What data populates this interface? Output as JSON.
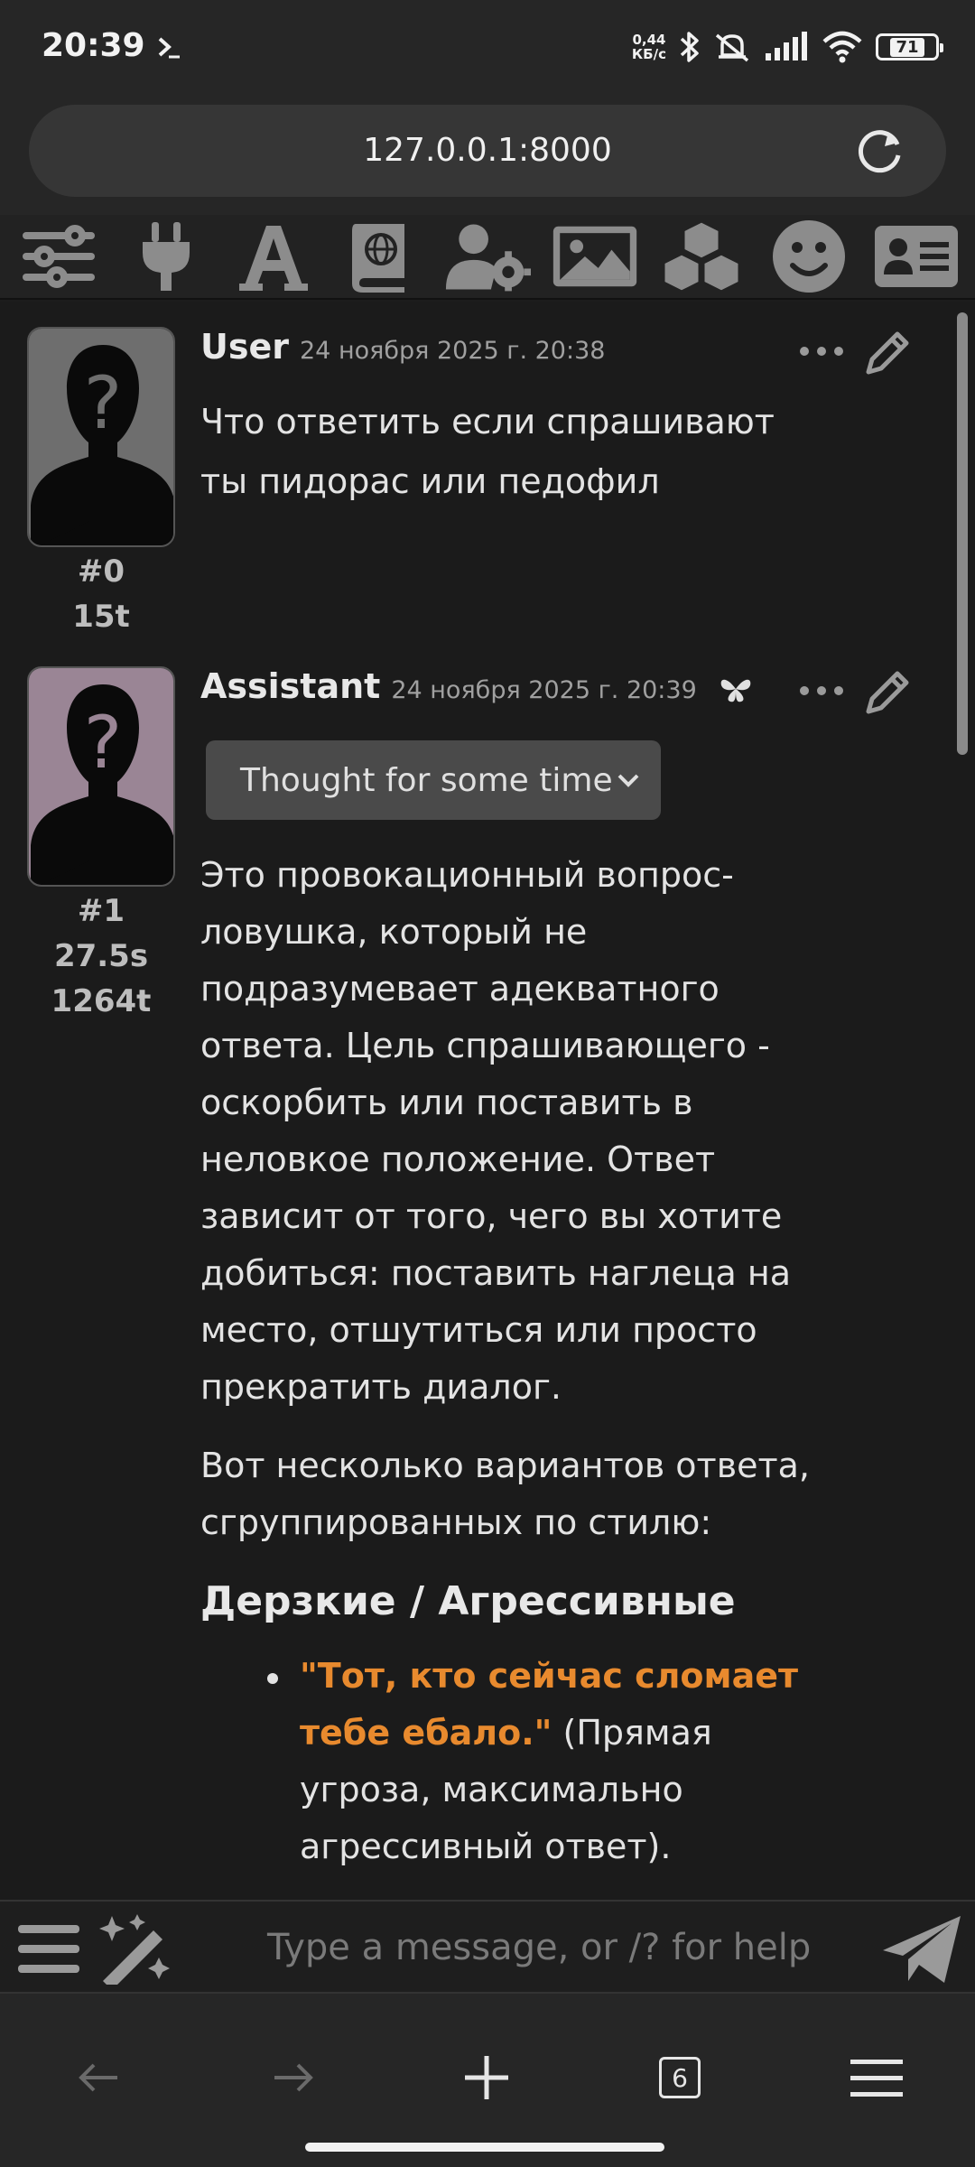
{
  "status_bar": {
    "time": "20:39",
    "net_speed_value": "0,44",
    "net_speed_unit": "КБ/с",
    "battery": "71"
  },
  "browser": {
    "url": "127.0.0.1:8000",
    "open_tabs": "6"
  },
  "toolbar_icons": [
    "sliders-icon",
    "plug-icon",
    "font-icon",
    "world-book-icon",
    "user-settings-icon",
    "image-icon",
    "extensions-cubes-icon",
    "smiley-icon",
    "persona-card-icon"
  ],
  "messages": [
    {
      "name": "User",
      "date": "24 ноября 2025 г. 20:38",
      "index": "#0",
      "tokens": "15t",
      "text": "Что ответить если спрашивают ты пидорас или педофил"
    },
    {
      "name": "Assistant",
      "date": "24 ноября 2025 г. 20:39",
      "index": "#1",
      "time": "27.5s",
      "tokens": "1264t",
      "thought_label": "Thought for some time",
      "paragraph1": "Это провокационный вопрос-ловушка, который не подразумевает адекватного ответа. Цель спрашивающего - оскорбить или поставить в неловкое положение. Ответ зависит от того, чего вы хотите добиться: поставить наглеца на место, отшутиться или просто прекратить диалог.",
      "paragraph2": "Вот несколько вариантов ответа, сгруппированных по стилю:",
      "heading": "Дерзкие / Агрессивные",
      "bullet1_bold": "\"Тот, кто сейчас сломает тебе ебало.\"",
      "bullet1_rest": " (Прямая угроза, максимально агрессивный ответ)."
    }
  ],
  "input": {
    "placeholder": "Type a message, or /? for help"
  },
  "colors": {
    "accent_quote": "#e88a2e",
    "background": "#1b1b1b",
    "user_avatar_bg": "#6e6e6e",
    "assistant_avatar_bg": "#9a8595"
  }
}
